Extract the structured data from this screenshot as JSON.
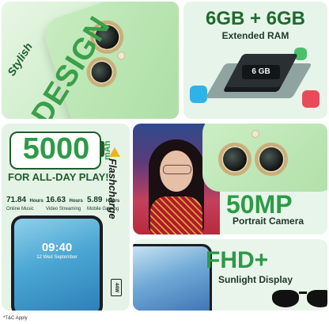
{
  "design": {
    "line1": "Stylish",
    "line2": "DESIGN"
  },
  "ram": {
    "title": "6GB + 6GB",
    "subtitle": "Extended RAM",
    "chip_label": "6 GB"
  },
  "battery": {
    "capacity": "5000",
    "unit": "mAh",
    "tagline": "FOR ALL-DAY PLAY!",
    "stats": [
      {
        "value": "71.84",
        "unit": "Hours",
        "label": "Online Music"
      },
      {
        "value": "16.63",
        "unit": "Hours",
        "label": "Video Streaming"
      },
      {
        "value": "5.89",
        "unit": "Hours",
        "label": "Mobile Gaming"
      }
    ],
    "lock_time": "09:40",
    "lock_date": "12 Wed September",
    "charge_name": "Flashcharge",
    "charge_watt": "44W"
  },
  "camera": {
    "title": "50MP",
    "subtitle": "Portrait Camera"
  },
  "display": {
    "title": "FHD+",
    "subtitle": "Sunlight Display"
  },
  "footer": {
    "disclaimer": "*T&C Apply"
  }
}
